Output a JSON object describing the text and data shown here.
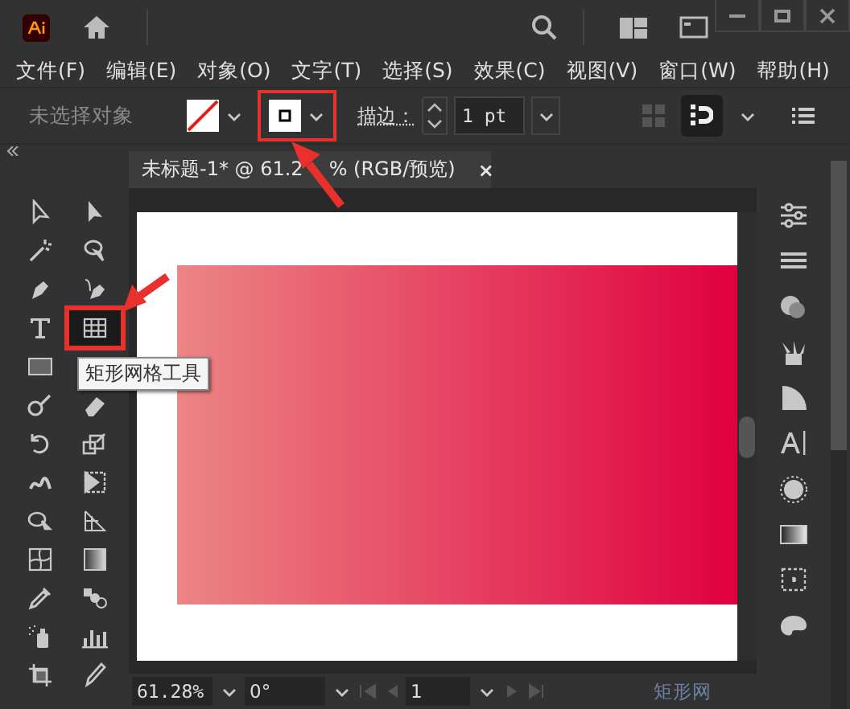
{
  "menu": [
    "文件(F)",
    "编辑(E)",
    "对象(O)",
    "文字(T)",
    "选择(S)",
    "效果(C)",
    "视图(V)",
    "窗口(W)",
    "帮助(H)"
  ],
  "control_bar": {
    "selection_status": "未选择对象",
    "stroke_label": "描边：",
    "stroke_value": "1 pt"
  },
  "document_tab": {
    "title_start": "未标题-1* @ 61.2",
    "title_end": "% (RGB/预览)",
    "close": "×"
  },
  "tools": [
    {
      "selected": false
    },
    {
      "selected": false
    },
    {
      "selected": false
    },
    {
      "selected": false
    },
    {
      "selected": false
    },
    {
      "selected": false
    },
    {
      "selected": false
    },
    {
      "selected": true
    },
    {
      "selected": false
    },
    {
      "selected": false
    },
    {
      "selected": false
    },
    {
      "selected": false
    },
    {
      "selected": false
    },
    {
      "selected": false
    },
    {
      "selected": false
    },
    {
      "selected": false
    },
    {
      "selected": false
    },
    {
      "selected": false
    },
    {
      "selected": false
    },
    {
      "selected": false
    },
    {
      "selected": false
    },
    {
      "selected": false
    },
    {
      "selected": false
    },
    {
      "selected": false
    },
    {
      "selected": false
    }
  ],
  "tooltip": "矩形网格工具",
  "status_bar": {
    "zoom": "61.28%",
    "rotation": "0°",
    "artboard": "1",
    "status_text": "矩形网"
  }
}
